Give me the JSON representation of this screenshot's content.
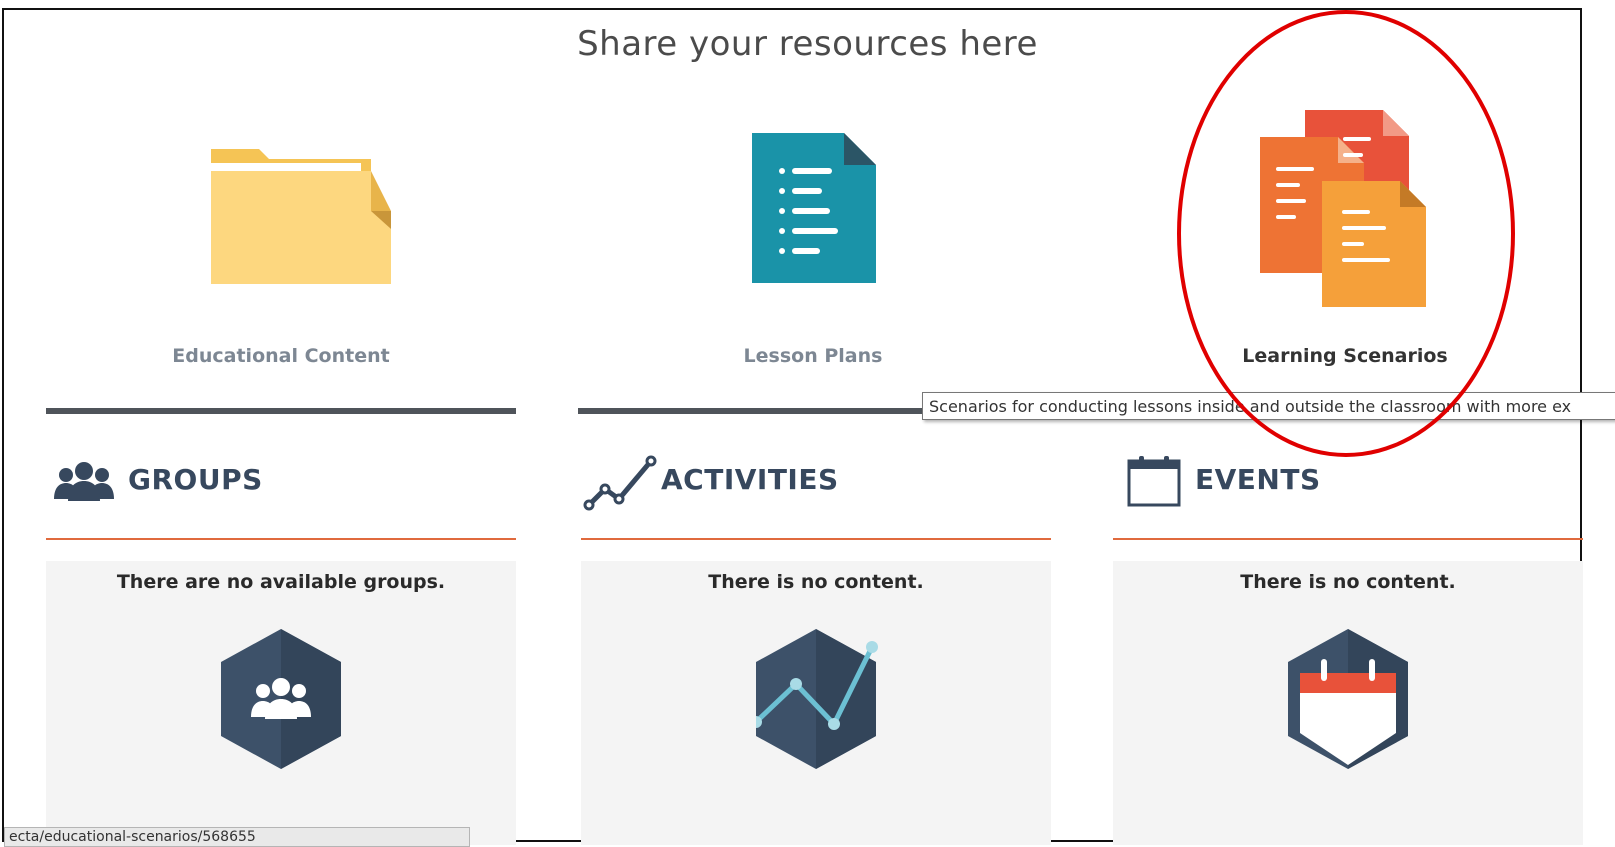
{
  "header": {
    "title": "Share your resources here"
  },
  "resources": [
    {
      "label": "Educational Content",
      "icon": "folder-icon"
    },
    {
      "label": "Lesson Plans",
      "icon": "document-list-icon"
    },
    {
      "label": "Learning Scenarios",
      "icon": "stacked-documents-icon"
    }
  ],
  "tooltip": {
    "text": "Scenarios for conducting lessons inside and outside the classroom with more ex"
  },
  "sections": [
    {
      "title": "GROUPS",
      "empty": "There are no available groups.",
      "icon": "users-icon"
    },
    {
      "title": "ACTIVITIES",
      "empty": "There is no content.",
      "icon": "line-chart-icon"
    },
    {
      "title": "EVENTS",
      "empty": "There is no content.",
      "icon": "calendar-icon"
    }
  ],
  "status_bar": {
    "url": "ecta/educational-scenarios/568655"
  },
  "colors": {
    "section_title": "#37485e",
    "accent_rule": "#e06a3d",
    "highlight": "#e00000",
    "folder": "#fdd47c",
    "lesson_plan": "#1a93a8",
    "scenarios": "#f39a3a"
  }
}
